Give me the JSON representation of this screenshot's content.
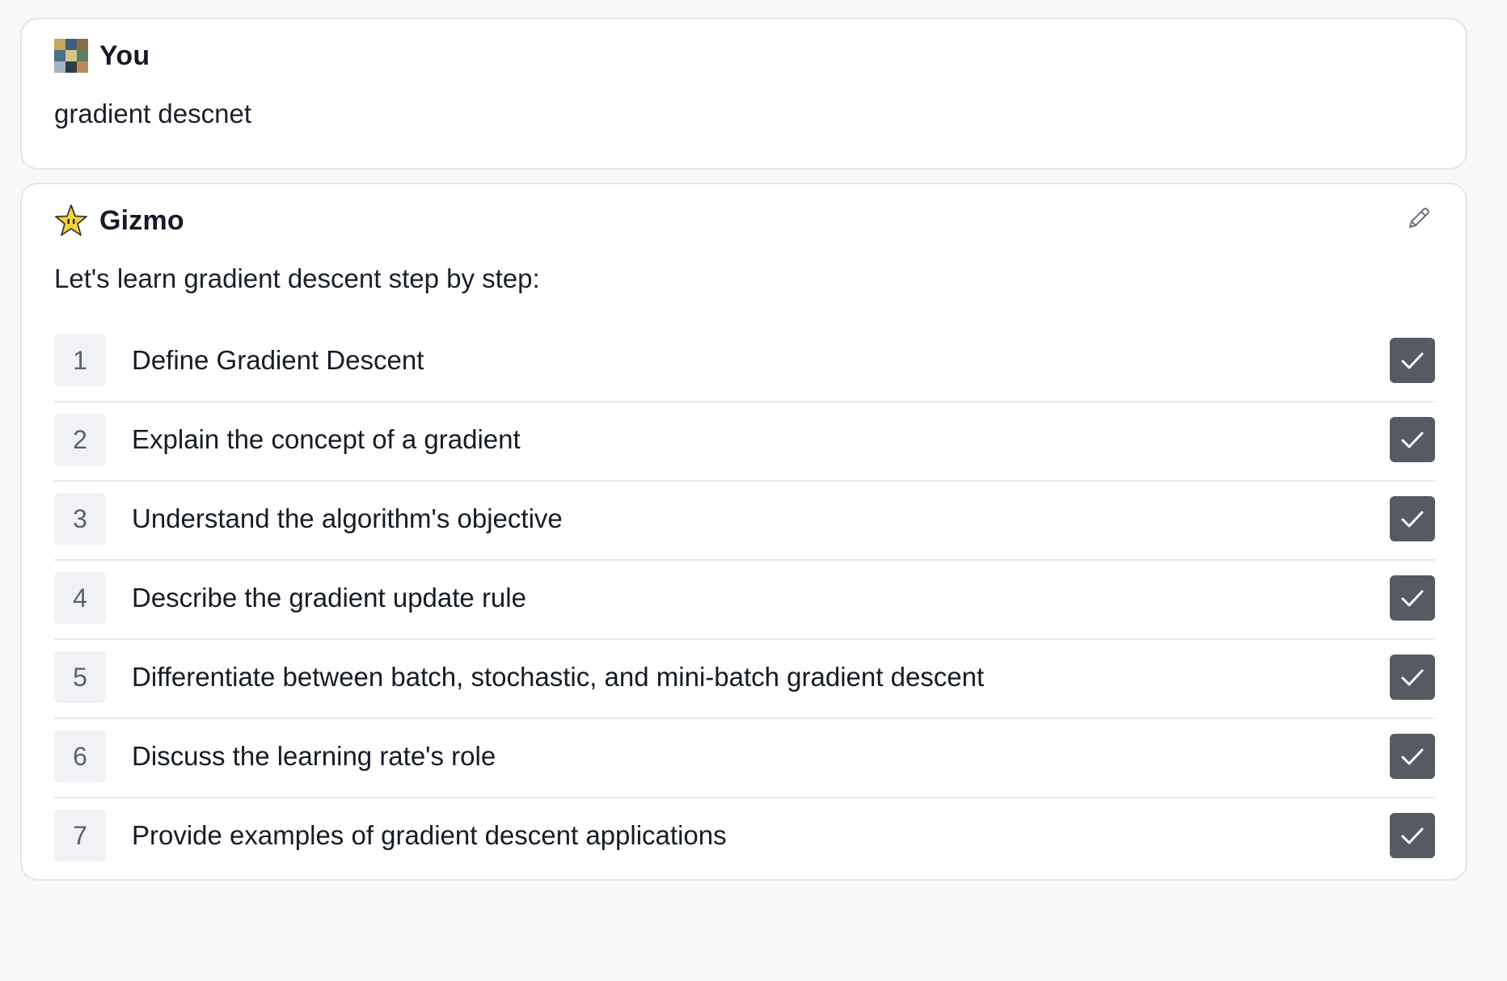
{
  "user_message": {
    "sender": "You",
    "avatar_icon": "user-avatar-image",
    "text": "gradient descnet"
  },
  "bot_message": {
    "sender": "Gizmo",
    "avatar_icon": "star-face-icon",
    "edit_icon": "pencil-icon",
    "intro": "Let's learn gradient descent step by step:",
    "steps": [
      {
        "number": "1",
        "label": "Define Gradient Descent",
        "checked": true
      },
      {
        "number": "2",
        "label": "Explain the concept of a gradient",
        "checked": true
      },
      {
        "number": "3",
        "label": "Understand the algorithm's objective",
        "checked": true
      },
      {
        "number": "4",
        "label": "Describe the gradient update rule",
        "checked": true
      },
      {
        "number": "5",
        "label": "Differentiate between batch, stochastic, and mini-batch gradient descent",
        "checked": true
      },
      {
        "number": "6",
        "label": "Discuss the learning rate's role",
        "checked": true
      },
      {
        "number": "7",
        "label": "Provide examples of gradient descent applications",
        "checked": true
      }
    ]
  },
  "colors": {
    "page_background": "#f8f9fb",
    "card_border": "#e3e6ec",
    "checkbox_fill": "#555a63",
    "step_number_bg": "#f1f2f5",
    "star_yellow": "#f5d33a"
  }
}
